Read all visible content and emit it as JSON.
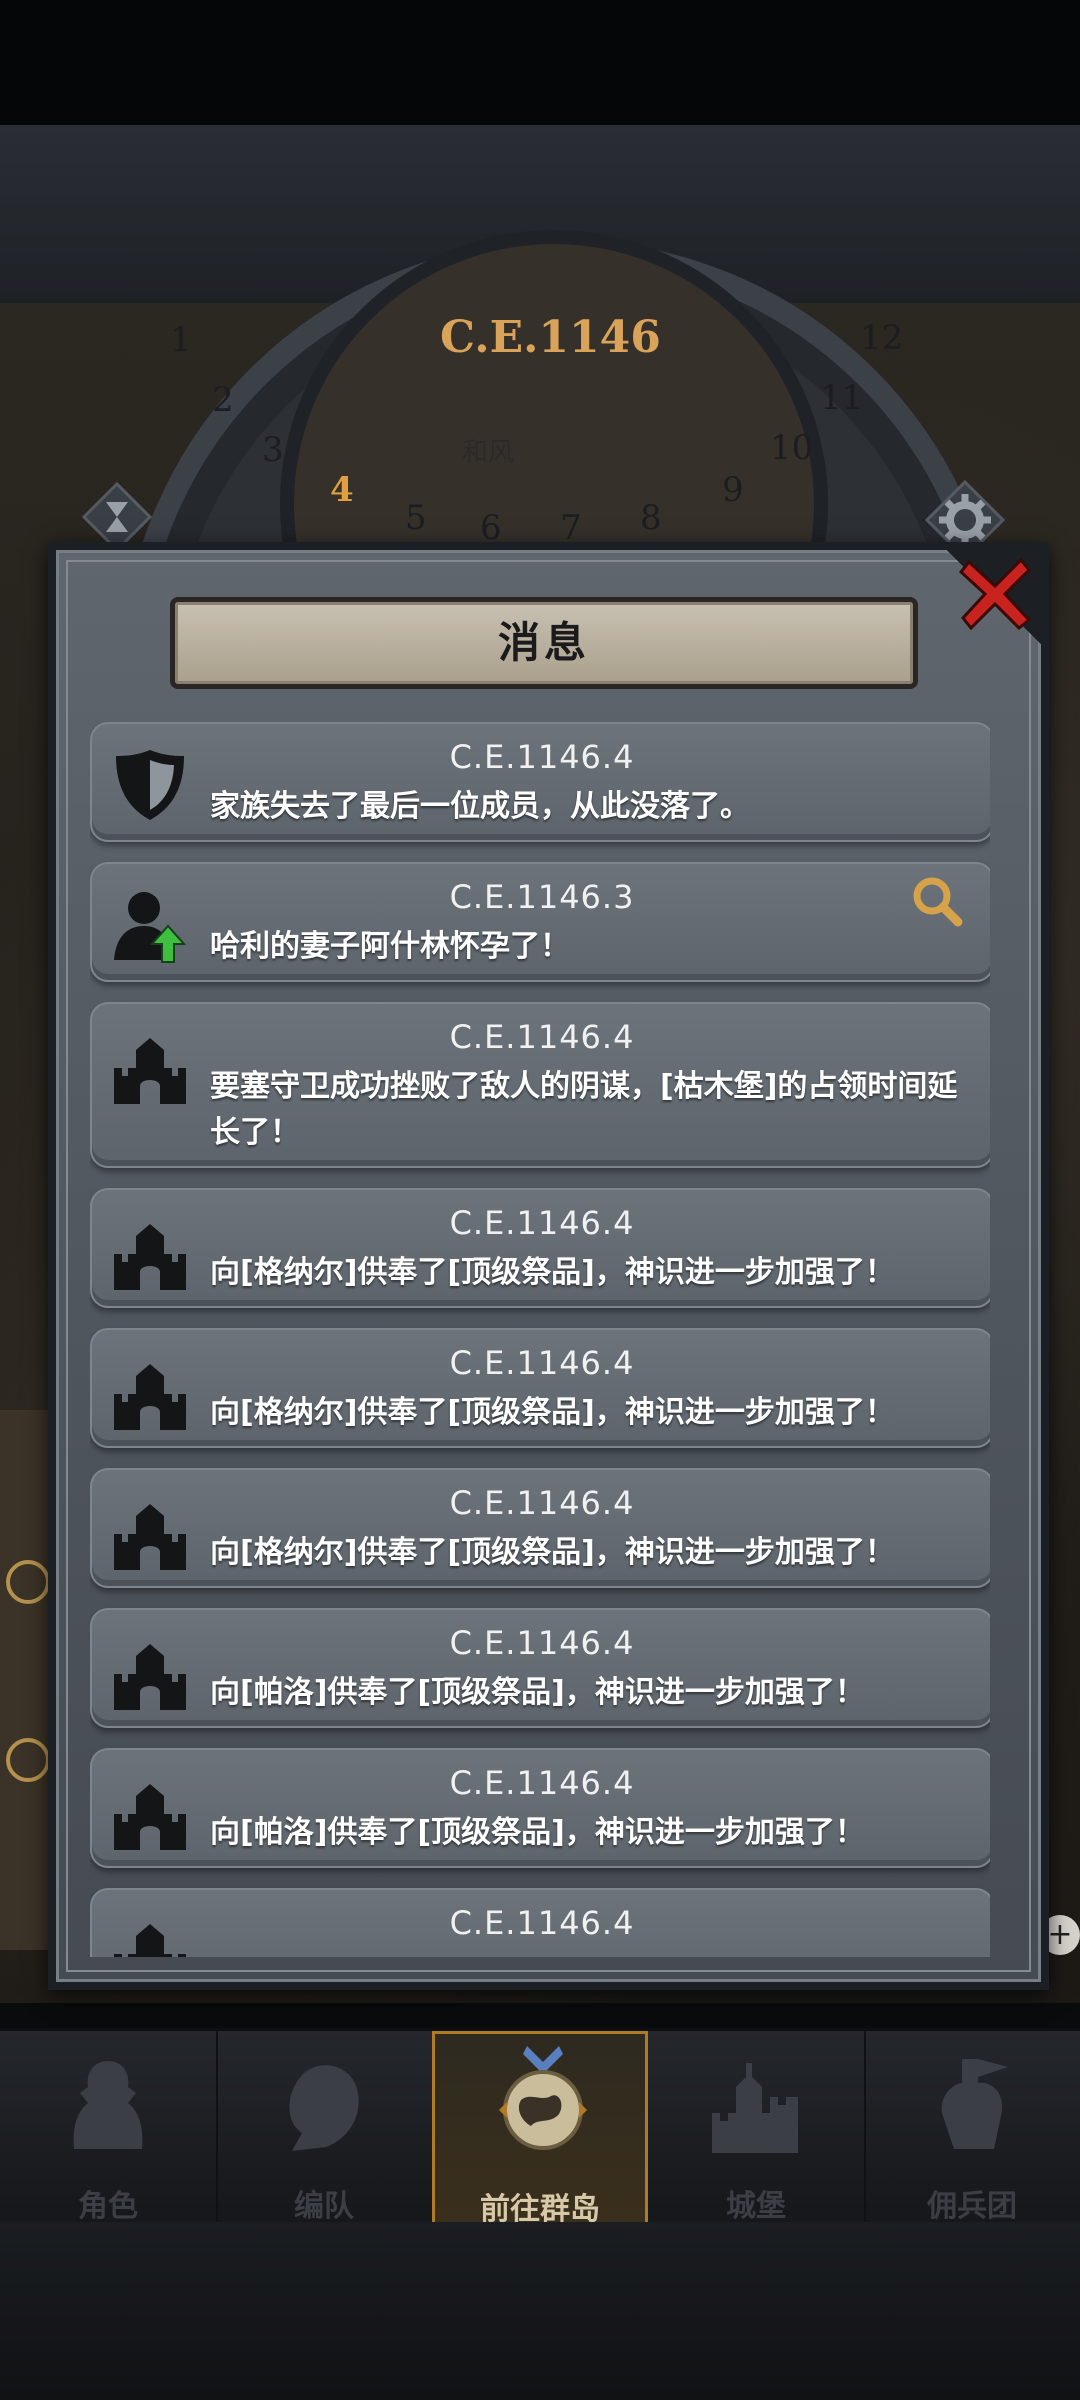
{
  "dialog": {
    "title": "消息"
  },
  "calendar": {
    "year": "C.E.1146",
    "numbers": [
      "1",
      "2",
      "3",
      "4",
      "5",
      "6",
      "7",
      "8",
      "9",
      "10",
      "11",
      "12"
    ],
    "active_month": "4",
    "sublabel": "和风"
  },
  "messages": [
    {
      "date": "C.E.1146.4",
      "text": "家族失去了最后一位成员，从此没落了。",
      "icon": "shield-icon"
    },
    {
      "date": "C.E.1146.3",
      "text": "哈利的妻子阿什林怀孕了！",
      "icon": "person-up-icon"
    },
    {
      "date": "C.E.1146.4",
      "text": "要塞守卫成功挫败了敌人的阴谋，[枯木堡]的占领时间延长了！",
      "icon": "castle-icon"
    },
    {
      "date": "C.E.1146.4",
      "text": "向[格纳尔]供奉了[顶级祭品]，神识进一步加强了！",
      "icon": "castle-icon"
    },
    {
      "date": "C.E.1146.4",
      "text": "向[格纳尔]供奉了[顶级祭品]，神识进一步加强了！",
      "icon": "castle-icon"
    },
    {
      "date": "C.E.1146.4",
      "text": "向[格纳尔]供奉了[顶级祭品]，神识进一步加强了！",
      "icon": "castle-icon"
    },
    {
      "date": "C.E.1146.4",
      "text": "向[帕洛]供奉了[顶级祭品]，神识进一步加强了！",
      "icon": "castle-icon"
    },
    {
      "date": "C.E.1146.4",
      "text": "向[帕洛]供奉了[顶级祭品]，神识进一步加强了！",
      "icon": "castle-icon"
    },
    {
      "date": "C.E.1146.4",
      "text": "",
      "icon": "castle-icon"
    }
  ],
  "nav": {
    "items": [
      "角色",
      "编队",
      "前往群岛",
      "城堡",
      "佣兵团"
    ],
    "active": "前往群岛"
  },
  "colors": {
    "accent_gold": "#d9a35a",
    "close_red": "#c8231f",
    "search_gold": "#d6a24a",
    "upgrade_green": "#3fbf3f"
  }
}
